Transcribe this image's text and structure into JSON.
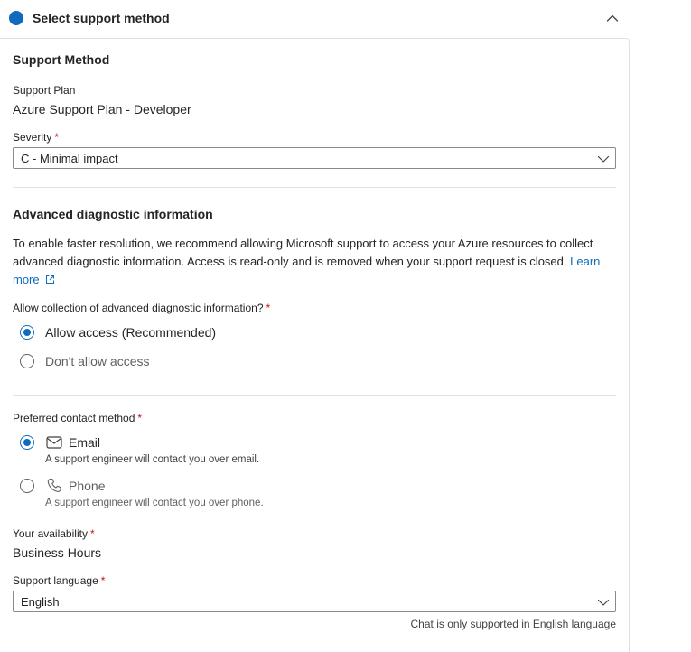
{
  "header": {
    "title": "Select support method",
    "accent_color": "#0f6cbd",
    "collapse_icon": "chevron-up-icon"
  },
  "support_method": {
    "title": "Support Method",
    "plan_label": "Support Plan",
    "plan_value": "Azure Support Plan - Developer",
    "severity_label": "Severity",
    "severity_required": "*",
    "severity_value": "C - Minimal impact"
  },
  "diagnostics": {
    "title": "Advanced diagnostic information",
    "description_line1": "To enable faster resolution, we recommend allowing Microsoft support to access your Azure resources to collect",
    "description_line2": "advanced diagnostic information. Access is read-only and is removed when your support request is closed.",
    "learn_more_part1": "Learn",
    "learn_more_part2": "more",
    "question": "Allow collection of advanced diagnostic information?",
    "question_required": "*",
    "options": [
      {
        "label": "Allow access (Recommended)",
        "selected": true
      },
      {
        "label": "Don't allow access",
        "selected": false
      }
    ]
  },
  "contact": {
    "label": "Preferred contact method",
    "required": "*",
    "options": [
      {
        "label": "Email",
        "icon": "mail-icon",
        "hint": "A support engineer will contact you over email.",
        "selected": true
      },
      {
        "label": "Phone",
        "icon": "phone-icon",
        "hint": "A support engineer will contact you over phone.",
        "selected": false
      }
    ]
  },
  "availability": {
    "label": "Your availability",
    "required": "*",
    "value": "Business Hours"
  },
  "language": {
    "label": "Support language",
    "required": "*",
    "value": "English",
    "note": "Chat is only supported in English language"
  }
}
